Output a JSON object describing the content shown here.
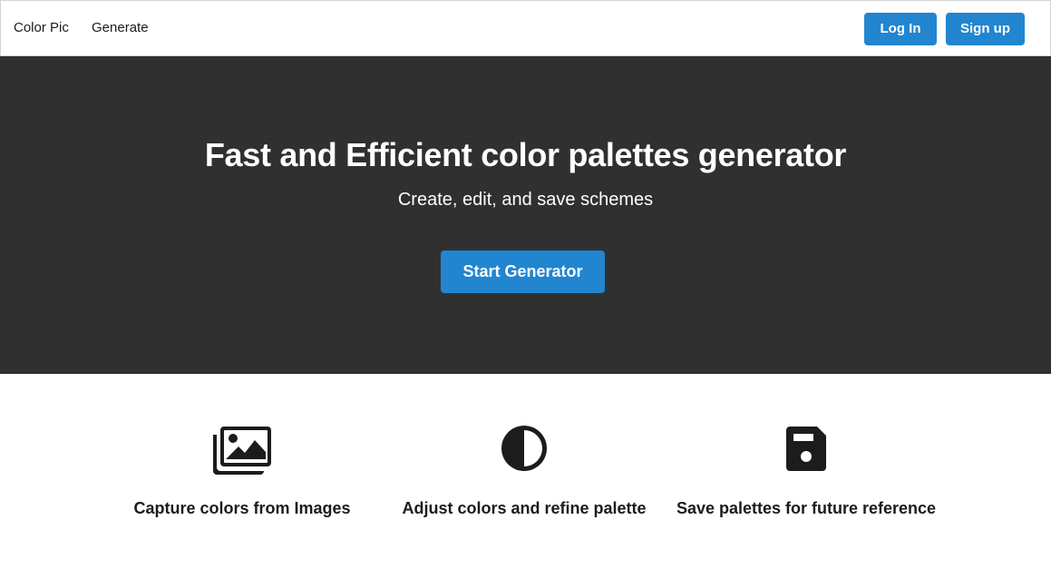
{
  "nav": {
    "brand": "Color Pic",
    "generate": "Generate",
    "login": "Log In",
    "signup": "Sign up"
  },
  "hero": {
    "title": "Fast and Efficient color palettes generator",
    "subtitle": "Create, edit, and save schemes",
    "cta": "Start Generator"
  },
  "features": [
    {
      "icon": "images-icon",
      "label": "Capture colors from Images"
    },
    {
      "icon": "adjust-contrast-icon",
      "label": "Adjust colors and refine palette"
    },
    {
      "icon": "save-floppy-icon",
      "label": "Save palettes for future reference"
    }
  ],
  "colors": {
    "accent": "#2185d0",
    "hero_background": "#303030",
    "text": "#1b1c1d"
  }
}
